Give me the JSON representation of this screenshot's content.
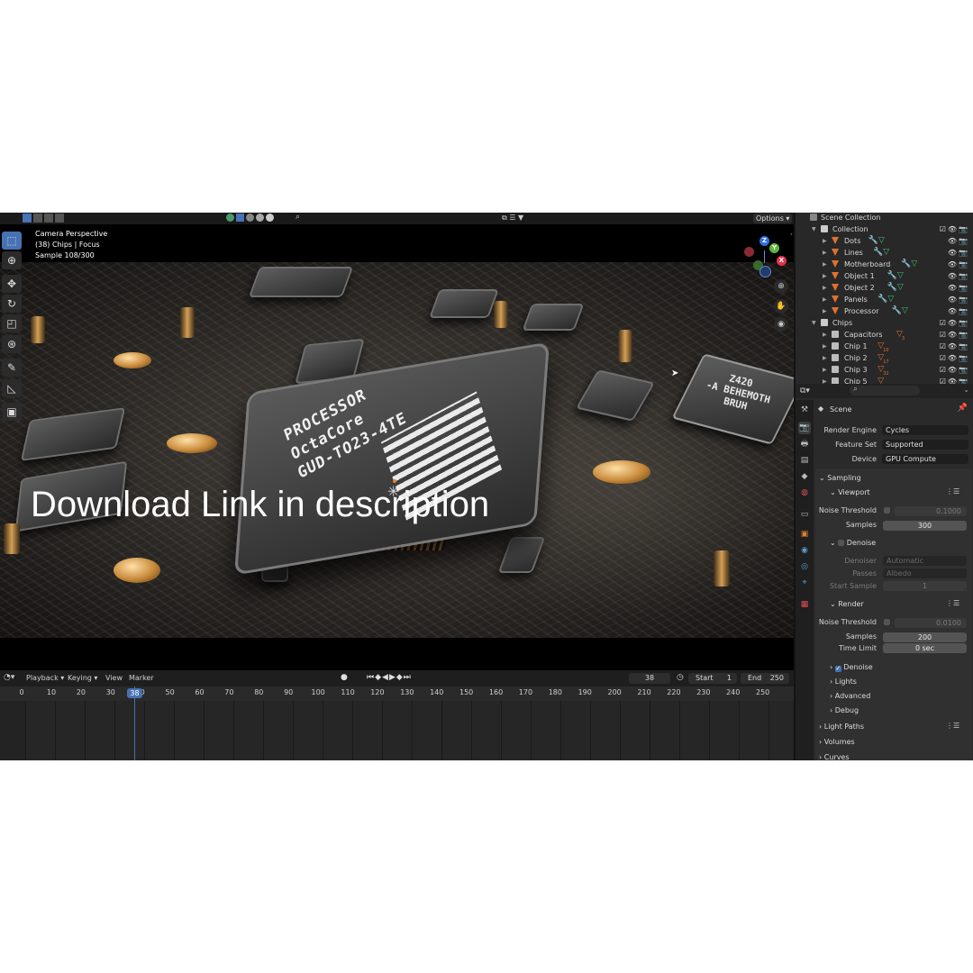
{
  "viewport": {
    "overlay": {
      "line1": "Camera Perspective",
      "line2": "(38) Chips | Focus",
      "line3": "Sample 108/300"
    },
    "header": {
      "options_label": "Options"
    },
    "render": {
      "cpu_label": "PROCESSOR\nOctaCore\nGUD-TO23-4TE",
      "chip_right_label": "Z420\n-A BEHEMOTH\nBRUH"
    },
    "gizmo": {
      "x": "X",
      "y": "Y",
      "z": "Z"
    },
    "tools": [
      "select-box-tool",
      "cursor-tool",
      "move-tool",
      "rotate-tool",
      "scale-tool",
      "transform-tool",
      "annotate-tool",
      "measure-tool",
      "add-cube-tool"
    ]
  },
  "timeline": {
    "menus": [
      "Playback",
      "Keying",
      "View",
      "Marker"
    ],
    "current_frame": "38",
    "start_label": "Start",
    "start_value": "1",
    "end_label": "End",
    "end_value": "250",
    "ruler": [
      "0",
      "10",
      "20",
      "30",
      "40",
      "50",
      "60",
      "70",
      "80",
      "90",
      "100",
      "110",
      "120",
      "130",
      "140",
      "150",
      "160",
      "170",
      "180",
      "190",
      "200",
      "210",
      "220",
      "230",
      "240",
      "250"
    ],
    "playhead_label": "38"
  },
  "overlay_caption": "Download Link in description",
  "outliner": {
    "root": "Scene Collection",
    "collection1": "Collection",
    "items1": [
      {
        "name": "Dots"
      },
      {
        "name": "Lines"
      },
      {
        "name": "Motherboard"
      },
      {
        "name": "Object 1"
      },
      {
        "name": "Object 2"
      },
      {
        "name": "Panels"
      },
      {
        "name": "Processor"
      }
    ],
    "collection2": "Chips",
    "items2": [
      {
        "name": "Capacitors",
        "badge": "3"
      },
      {
        "name": "Chip 1",
        "badge": "10"
      },
      {
        "name": "Chip 2",
        "badge": "17"
      },
      {
        "name": "Chip 3",
        "badge": "32"
      },
      {
        "name": "Chip 5",
        "badge": ""
      }
    ]
  },
  "properties": {
    "context": "Scene",
    "render_engine_label": "Render Engine",
    "render_engine_value": "Cycles",
    "feature_set_label": "Feature Set",
    "feature_set_value": "Supported",
    "device_label": "Device",
    "device_value": "GPU Compute",
    "sampling": "Sampling",
    "viewport": "Viewport",
    "vp_noise_label": "Noise Threshold",
    "vp_noise_value": "0.1000",
    "vp_samples_label": "Samples",
    "vp_samples_value": "300",
    "vp_denoise": "Denoise",
    "denoiser_label": "Denoiser",
    "denoiser_value": "Automatic",
    "passes_label": "Passes",
    "passes_value": "Albedo",
    "start_sample_label": "Start Sample",
    "start_sample_value": "1",
    "render": "Render",
    "r_noise_label": "Noise Threshold",
    "r_noise_value": "0.0100",
    "r_samples_label": "Samples",
    "r_samples_value": "200",
    "r_time_label": "Time Limit",
    "r_time_value": "0 sec",
    "r_denoise": "Denoise",
    "lights": "Lights",
    "advanced": "Advanced",
    "debug": "Debug",
    "light_paths": "Light Paths",
    "volumes": "Volumes",
    "curves": "Curves"
  },
  "colors": {
    "accent": "#4772b3",
    "panel": "#2a2a2a",
    "header": "#1d1d1d",
    "mesh_orange": "#e07030",
    "modifier_blue": "#5b9bd5",
    "data_green": "#3fbf6f"
  }
}
